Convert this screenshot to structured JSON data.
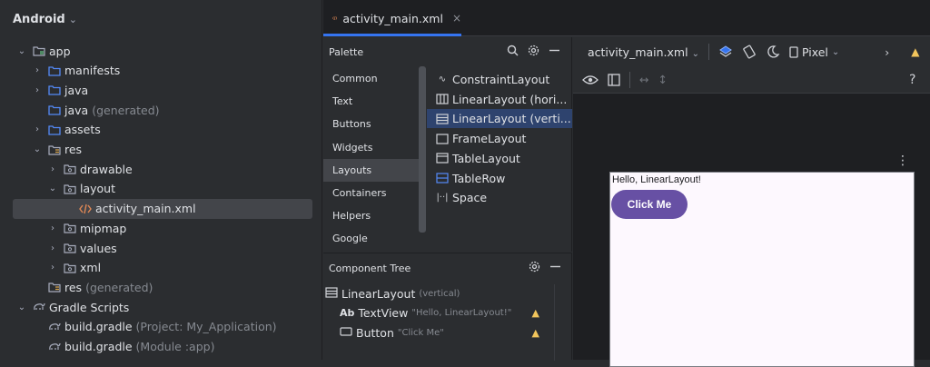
{
  "project": {
    "header": "Android",
    "tree": [
      {
        "label": "app",
        "suffix": "",
        "level": 0,
        "arrow": "⌄",
        "icon": "module-icon"
      },
      {
        "label": "manifests",
        "suffix": "",
        "level": 1,
        "arrow": "›",
        "icon": "folder-icon"
      },
      {
        "label": "java",
        "suffix": "",
        "level": 1,
        "arrow": "›",
        "icon": "folder-icon"
      },
      {
        "label": "java",
        "suffix": "(generated)",
        "level": 1,
        "arrow": "",
        "icon": "folder-icon"
      },
      {
        "label": "assets",
        "suffix": "",
        "level": 1,
        "arrow": "›",
        "icon": "folder-icon"
      },
      {
        "label": "res",
        "suffix": "",
        "level": 1,
        "arrow": "⌄",
        "icon": "res-folder-icon"
      },
      {
        "label": "drawable",
        "suffix": "",
        "level": 2,
        "arrow": "›",
        "icon": "package-icon"
      },
      {
        "label": "layout",
        "suffix": "",
        "level": 2,
        "arrow": "⌄",
        "icon": "package-icon"
      },
      {
        "label": "activity_main.xml",
        "suffix": "",
        "level": 3,
        "arrow": "",
        "icon": "xml-file-icon",
        "selected": true
      },
      {
        "label": "mipmap",
        "suffix": "",
        "level": 2,
        "arrow": "›",
        "icon": "package-icon"
      },
      {
        "label": "values",
        "suffix": "",
        "level": 2,
        "arrow": "›",
        "icon": "package-icon"
      },
      {
        "label": "xml",
        "suffix": "",
        "level": 2,
        "arrow": "›",
        "icon": "package-icon"
      },
      {
        "label": "res",
        "suffix": "(generated)",
        "level": 1,
        "arrow": "",
        "icon": "res-folder-icon"
      },
      {
        "label": "Gradle Scripts",
        "suffix": "",
        "level": 0,
        "arrow": "⌄",
        "icon": "gradle-icon"
      },
      {
        "label": "build.gradle",
        "suffix": "(Project: My_Application)",
        "level": 1,
        "arrow": "",
        "icon": "gradle-icon"
      },
      {
        "label": "build.gradle",
        "suffix": "(Module :app)",
        "level": 1,
        "arrow": "",
        "icon": "gradle-icon"
      }
    ]
  },
  "editor": {
    "tab_label": "activity_main.xml",
    "tab_close": "×"
  },
  "palette": {
    "title": "Palette",
    "categories": [
      "Common",
      "Text",
      "Buttons",
      "Widgets",
      "Layouts",
      "Containers",
      "Helpers",
      "Google"
    ],
    "selected_category": "Layouts",
    "items": [
      {
        "label": "ConstraintLayout",
        "icon": "constraint-layout-icon",
        "glyph": "∿"
      },
      {
        "label": "LinearLayout (hori...",
        "icon": "linear-horizontal-icon",
        "glyph": ""
      },
      {
        "label": "LinearLayout (verti...",
        "icon": "linear-vertical-icon",
        "glyph": "",
        "selected": true
      },
      {
        "label": "FrameLayout",
        "icon": "frame-layout-icon",
        "glyph": ""
      },
      {
        "label": "TableLayout",
        "icon": "table-layout-icon",
        "glyph": ""
      },
      {
        "label": "TableRow",
        "icon": "table-row-icon",
        "glyph": ""
      },
      {
        "label": "Space",
        "icon": "space-icon",
        "glyph": "|··|"
      }
    ]
  },
  "component_tree": {
    "title": "Component Tree",
    "rows": [
      {
        "label": "LinearLayout",
        "hint": "(vertical)",
        "prefix": "",
        "warn": false
      },
      {
        "label": "TextView",
        "hint": "\"Hello, LinearLayout!\"",
        "prefix": "Ab",
        "warn": true
      },
      {
        "label": "Button",
        "hint": "\"Click Me\"",
        "prefix": "",
        "warn": true
      }
    ]
  },
  "design": {
    "file_dropdown": "activity_main.xml",
    "device_dropdown": "Pixel",
    "help": "?",
    "more": "⋮",
    "preview": {
      "text": "Hello, LinearLayout!",
      "button": "Click Me"
    }
  },
  "colors": {
    "accent": "#3574f0",
    "button": "#6750a4",
    "warning": "#f2c55c"
  }
}
